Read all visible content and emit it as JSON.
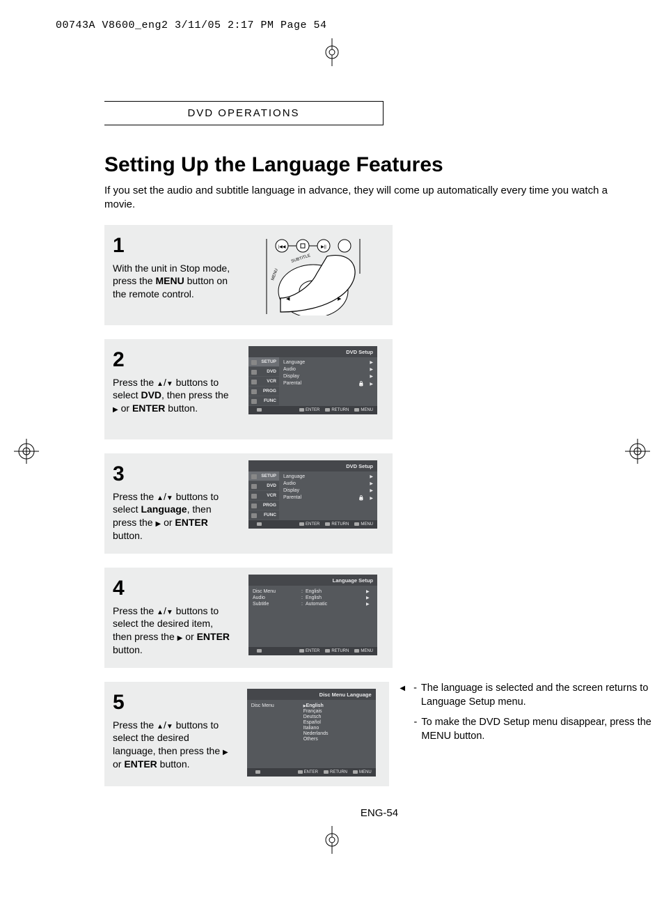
{
  "runner": "00743A V8600_eng2  3/11/05  2:17 PM  Page 54",
  "section_header": "DVD OPERATIONS",
  "title": "Setting Up the Language Features",
  "intro": "If you set the audio and subtitle language in advance, they will come up automatically every time you watch a movie.",
  "steps": [
    {
      "num": "1",
      "text_pre": "With the unit in Stop mode, press the ",
      "bold1": "MENU",
      "text_post": " button on the remote control."
    },
    {
      "num": "2",
      "text_pre": "Press the ",
      "updown": true,
      "text_mid": " buttons to select ",
      "bold1": "DVD",
      "text_mid2": ", then press the ",
      "right": true,
      "text_mid3": " or ",
      "bold2": "ENTER",
      "text_post": " button."
    },
    {
      "num": "3",
      "text_pre": "Press the ",
      "updown": true,
      "text_mid": " buttons to select ",
      "bold1": "Language",
      "text_mid2": ", then press the ",
      "right": true,
      "text_mid3": " or ",
      "bold2": "ENTER",
      "text_post": " button."
    },
    {
      "num": "4",
      "text_pre": "Press the ",
      "updown": true,
      "text_mid": " buttons to select the desired item, then press the ",
      "right": true,
      "text_mid3": " or ",
      "bold2": "ENTER",
      "text_post": " button."
    },
    {
      "num": "5",
      "text_pre": "Press the ",
      "updown": true,
      "text_mid": " buttons to select the desired language, then press the ",
      "right": true,
      "text_mid3": " or ",
      "bold2": "ENTER",
      "text_post": " button."
    }
  ],
  "osd_dvd_setup": {
    "title": "DVD Setup",
    "tabs": [
      "SETUP",
      "DVD",
      "VCR",
      "PROG",
      "FUNC"
    ],
    "items": [
      "Language",
      "Audio",
      "Display",
      "Parental"
    ],
    "foot": [
      "ENTER",
      "RETURN",
      "MENU"
    ]
  },
  "osd_lang_setup": {
    "title": "Language Setup",
    "rows": [
      {
        "k": "Disc Menu",
        "v": "English"
      },
      {
        "k": "Audio",
        "v": "English"
      },
      {
        "k": "Subtitle",
        "v": "Automatic"
      }
    ],
    "foot": [
      "ENTER",
      "RETURN",
      "MENU"
    ]
  },
  "osd_disc_menu_lang": {
    "title": "Disc Menu Language",
    "left": "Disc Menu",
    "langs": [
      "English",
      "Français",
      "Deutsch",
      "Español",
      "Italiano",
      "Nederlands",
      "Others"
    ],
    "foot": [
      "ENTER",
      "RETURN",
      "MENU"
    ]
  },
  "side_notes": [
    "The language is selected and the screen returns to Language Setup menu.",
    "To make the DVD Setup menu disappear, press the MENU button."
  ],
  "page_number": "ENG-54"
}
